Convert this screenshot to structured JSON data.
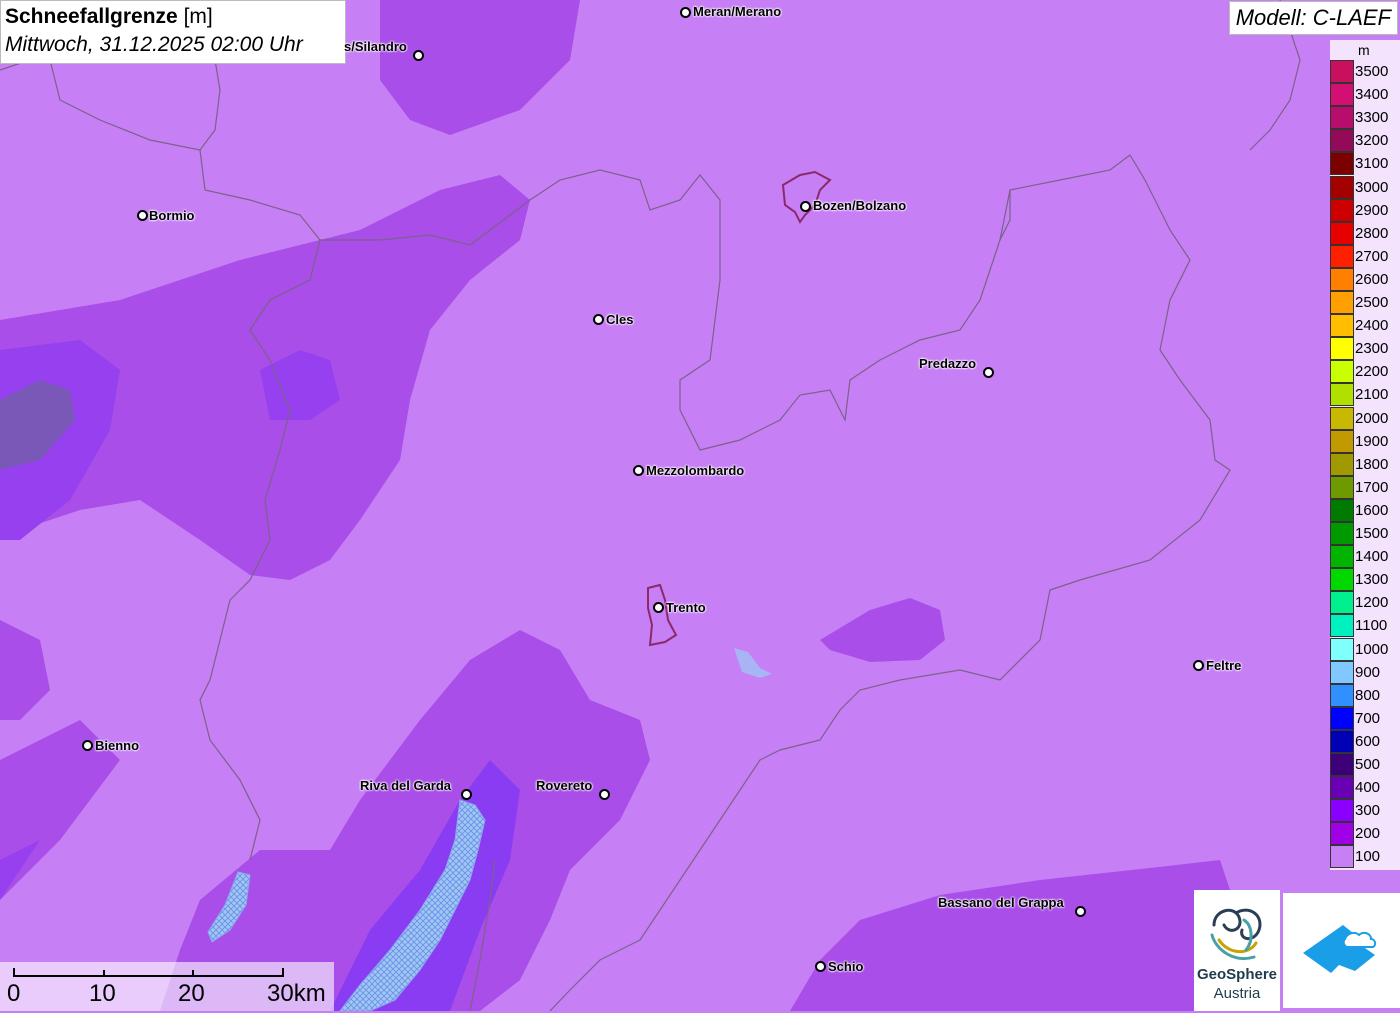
{
  "title": {
    "parameter": "Schneefallgrenze",
    "unit": "[m]",
    "datetime": "Mittwoch, 31.12.2025 02:00 Uhr"
  },
  "model": "Modell: C-LAEF",
  "legend": {
    "unit": "m",
    "items": [
      {
        "label": "3500",
        "color": "#c8105e"
      },
      {
        "label": "3400",
        "color": "#d30f73"
      },
      {
        "label": "3300",
        "color": "#b80d6c"
      },
      {
        "label": "3200",
        "color": "#930b58"
      },
      {
        "label": "3100",
        "color": "#7d0000"
      },
      {
        "label": "3000",
        "color": "#a50000"
      },
      {
        "label": "2900",
        "color": "#cc0000"
      },
      {
        "label": "2800",
        "color": "#e60000"
      },
      {
        "label": "2700",
        "color": "#ff2000"
      },
      {
        "label": "2600",
        "color": "#ff7f00"
      },
      {
        "label": "2500",
        "color": "#ffa000"
      },
      {
        "label": "2400",
        "color": "#ffbf00"
      },
      {
        "label": "2300",
        "color": "#ffff00"
      },
      {
        "label": "2200",
        "color": "#c9ff00"
      },
      {
        "label": "2100",
        "color": "#b0e000"
      },
      {
        "label": "2000",
        "color": "#c8b800"
      },
      {
        "label": "1900",
        "color": "#c09a00"
      },
      {
        "label": "1800",
        "color": "#a09a00"
      },
      {
        "label": "1700",
        "color": "#6e9a00"
      },
      {
        "label": "1600",
        "color": "#007a00"
      },
      {
        "label": "1500",
        "color": "#009a00"
      },
      {
        "label": "1400",
        "color": "#00b400"
      },
      {
        "label": "1300",
        "color": "#00d800"
      },
      {
        "label": "1200",
        "color": "#00f090"
      },
      {
        "label": "1100",
        "color": "#00f0c0"
      },
      {
        "label": "1000",
        "color": "#80ffff"
      },
      {
        "label": "900",
        "color": "#80c8ff"
      },
      {
        "label": "800",
        "color": "#3090ff"
      },
      {
        "label": "700",
        "color": "#0000ff"
      },
      {
        "label": "600",
        "color": "#0000b4"
      },
      {
        "label": "500",
        "color": "#3c0078"
      },
      {
        "label": "400",
        "color": "#6a00b4"
      },
      {
        "label": "300",
        "color": "#8a00ff"
      },
      {
        "label": "200",
        "color": "#a000e6"
      },
      {
        "label": "100",
        "color": "#c77ff5"
      }
    ]
  },
  "cities": [
    {
      "name": "Meran/Merano"
    },
    {
      "name": "s/Silandro"
    },
    {
      "name": "Bormio"
    },
    {
      "name": "Bozen/Bolzano"
    },
    {
      "name": "Cles"
    },
    {
      "name": "Predazzo"
    },
    {
      "name": "Mezzolombardo"
    },
    {
      "name": "Trento"
    },
    {
      "name": "Feltre"
    },
    {
      "name": "Bienno"
    },
    {
      "name": "Riva del Garda"
    },
    {
      "name": "Rovereto"
    },
    {
      "name": "Bassano del Grappa"
    },
    {
      "name": "Schio"
    }
  ],
  "scalebar": {
    "labels": [
      "0",
      "10",
      "20",
      "30km"
    ]
  },
  "logos": {
    "geosphere_line1": "GeoSphere",
    "geosphere_line2": "Austria"
  }
}
